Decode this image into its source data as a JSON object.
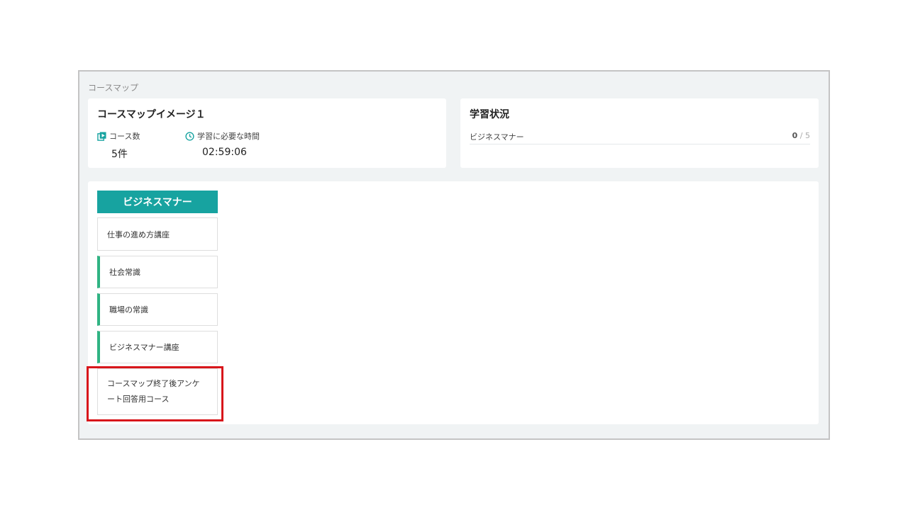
{
  "section_title": "コースマップ",
  "info": {
    "title": "コースマップイメージ１",
    "course_count_label": "コース数",
    "course_count_value": "5件",
    "time_label": "学習に必要な時間",
    "time_value": "02:59:06",
    "course_count_icon": "play-book-icon",
    "time_icon": "clock-icon"
  },
  "status": {
    "title": "学習状況",
    "rows": [
      {
        "name": "ビジネスマナー",
        "done": "0",
        "total": "/ 5"
      }
    ]
  },
  "map": {
    "category": "ビジネスマナー",
    "courses": [
      {
        "label": "仕事の進め方講座"
      },
      {
        "label": "社会常識"
      },
      {
        "label": "職場の常識"
      },
      {
        "label": "ビジネスマナー講座"
      },
      {
        "label_line1": "コースマップ終了後アンケ",
        "label_line2": "ート回答用コース"
      }
    ]
  },
  "colors": {
    "accent": "#17a3a0",
    "progress_bar": "#2fb383",
    "highlight": "#d8161b",
    "background": "#f0f3f4"
  }
}
